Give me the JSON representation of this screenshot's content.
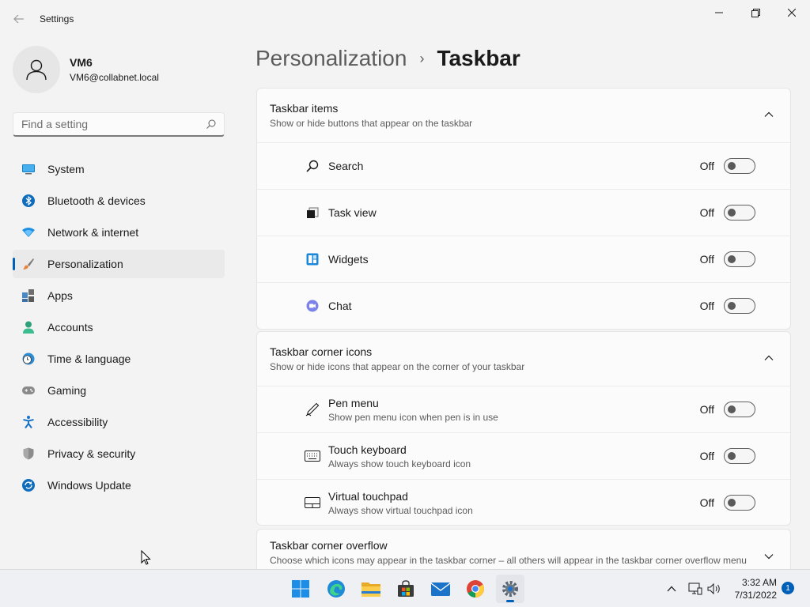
{
  "window": {
    "title": "Settings"
  },
  "profile": {
    "name": "VM6",
    "email": "VM6@collabnet.local"
  },
  "search": {
    "placeholder": "Find a setting"
  },
  "sidebar": {
    "items": [
      {
        "label": "System",
        "icon": "monitor-icon"
      },
      {
        "label": "Bluetooth & devices",
        "icon": "bluetooth-icon"
      },
      {
        "label": "Network & internet",
        "icon": "wifi-icon"
      },
      {
        "label": "Personalization",
        "icon": "brush-icon",
        "active": true
      },
      {
        "label": "Apps",
        "icon": "apps-icon"
      },
      {
        "label": "Accounts",
        "icon": "person-icon"
      },
      {
        "label": "Time & language",
        "icon": "clock-globe-icon"
      },
      {
        "label": "Gaming",
        "icon": "gamepad-icon"
      },
      {
        "label": "Accessibility",
        "icon": "accessibility-icon"
      },
      {
        "label": "Privacy & security",
        "icon": "shield-icon"
      },
      {
        "label": "Windows Update",
        "icon": "update-icon"
      }
    ]
  },
  "breadcrumb": {
    "parent": "Personalization",
    "separator": "›",
    "current": "Taskbar"
  },
  "sections": {
    "taskbar_items": {
      "title": "Taskbar items",
      "subtitle": "Show or hide buttons that appear on the taskbar",
      "expanded": true,
      "rows": [
        {
          "label": "Search",
          "state": "Off",
          "icon": "search-icon"
        },
        {
          "label": "Task view",
          "state": "Off",
          "icon": "task-view-icon"
        },
        {
          "label": "Widgets",
          "state": "Off",
          "icon": "widgets-icon"
        },
        {
          "label": "Chat",
          "state": "Off",
          "icon": "chat-icon"
        }
      ]
    },
    "corner_icons": {
      "title": "Taskbar corner icons",
      "subtitle": "Show or hide icons that appear on the corner of your taskbar",
      "expanded": true,
      "rows": [
        {
          "label": "Pen menu",
          "sub": "Show pen menu icon when pen is in use",
          "state": "Off",
          "icon": "pen-icon"
        },
        {
          "label": "Touch keyboard",
          "sub": "Always show touch keyboard icon",
          "state": "Off",
          "icon": "keyboard-icon"
        },
        {
          "label": "Virtual touchpad",
          "sub": "Always show virtual touchpad icon",
          "state": "Off",
          "icon": "touchpad-icon"
        }
      ]
    },
    "corner_overflow": {
      "title": "Taskbar corner overflow",
      "subtitle": "Choose which icons may appear in the taskbar corner – all others will appear in the taskbar corner overflow menu",
      "expanded": false
    }
  },
  "taskbar": {
    "apps": [
      "start-icon",
      "edge-icon",
      "file-explorer-icon",
      "store-icon",
      "mail-icon",
      "chrome-icon",
      "settings-icon"
    ],
    "clock": {
      "time": "3:32 AM",
      "date": "7/31/2022"
    },
    "notification_count": "1"
  },
  "colors": {
    "accent": "#005fb8",
    "background": "#f3f3f3",
    "card": "#fbfbfb"
  }
}
